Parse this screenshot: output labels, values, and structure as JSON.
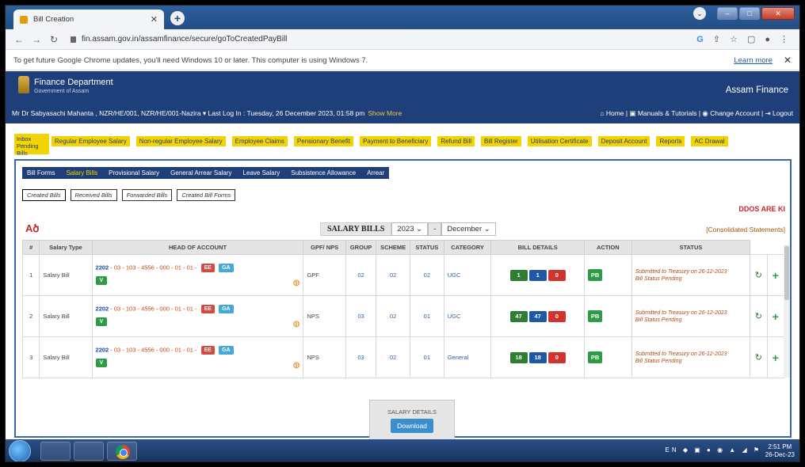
{
  "browser": {
    "tab_title": "Bill Creation",
    "url": "fin.assam.gov.in/assamfinance/secure/goToCreatedPayBill"
  },
  "infobar": {
    "message": "To get future Google Chrome updates, you'll need Windows 10 or later. This computer is using Windows 7.",
    "learn_more": "Learn more"
  },
  "site": {
    "dept": "Finance Department",
    "gov": "Government of Assam",
    "brand": "Assam Finance",
    "user_info": "Mr Dr Sabyasachi Mahanta , NZR/HE/001, NZR/HE/001-Nazira ▾   Last Log In : Tuesday, 26 December 2023, 01:58 pm",
    "show_more": "Show More",
    "user_links": "⌂ Home | ▣ Manuals & Tutorials | ◉ Change Account | ⇥ Logout"
  },
  "menu": {
    "inbox": "Inbox",
    "pending": "Pending Bills",
    "items": [
      "Regular Employee Salary",
      "Non-regular Employee Salary",
      "Employee Claims",
      "Pensionary Benefit",
      "Payment to Beneficiary",
      "Refund Bill",
      "Bill Register",
      "Utilisation Certificate",
      "Deposit Account",
      "Reports",
      "AC Drawal"
    ]
  },
  "subnav": [
    "Bill Forms",
    "Salary Bills",
    "Provisional Salary",
    "General Arrear Salary",
    "Leave Salary",
    "Subsistence Allowance",
    "Arrear"
  ],
  "subbuttons": [
    "Created Bills",
    "Received Bills",
    "Forwarded Bills",
    "Created Bill Forms"
  ],
  "ddos": "DDOS ARE KI",
  "ao_icon": "Aծ",
  "salary": {
    "label": "SALARY BILLS",
    "year": "2023",
    "month": "December",
    "consolidated": "[Consolidated Statements]"
  },
  "table": {
    "headers": [
      "#",
      "Salary Type",
      "HEAD OF ACCOUNT",
      "GPF/ NPS",
      "GROUP",
      "SCHEME",
      "STATUS",
      "CATEGORY",
      "BILL DETAILS",
      "ACTION",
      "STATUS"
    ],
    "rows": [
      {
        "n": "1",
        "type": "Salary Bill",
        "hoa_head": "2202",
        "hoa_rest": " - 03 - 103 - 4556 - 000 - 01 - 01 -",
        "gpf": "GPF",
        "group": "02",
        "scheme": "02",
        "status": "02",
        "category": "UGC",
        "d1": "1",
        "d2": "1",
        "d3": "0",
        "action": "PB",
        "stat1": "Submitted to Treasury on 26-12-2023",
        "stat2": "Bill Status Pending"
      },
      {
        "n": "2",
        "type": "Salary Bill",
        "hoa_head": "2202",
        "hoa_rest": " - 03 - 103 - 4556 - 000 - 01 - 01 -",
        "gpf": "NPS",
        "group": "03",
        "scheme": "02",
        "status": "01",
        "category": "UGC",
        "d1": "47",
        "d2": "47",
        "d3": "0",
        "action": "PB",
        "stat1": "Submitted to Treasury on 26-12-2023",
        "stat2": "Bill Status Pending"
      },
      {
        "n": "3",
        "type": "Salary Bill",
        "hoa_head": "2202",
        "hoa_rest": " - 03 - 103 - 4556 - 000 - 01 - 01 -",
        "gpf": "NPS",
        "group": "03",
        "scheme": "02",
        "status": "01",
        "category": "General",
        "d1": "18",
        "d2": "18",
        "d3": "0",
        "action": "PB",
        "stat1": "Submitted to Treasury on 26-12-2023",
        "stat2": "Bill Status Pending"
      }
    ],
    "badge_ee": "EE",
    "badge_ga": "GA",
    "badge_v": "V"
  },
  "download": {
    "title": "SALARY DETAILS",
    "button": "Download"
  },
  "taskbar": {
    "lang": "EN",
    "time": "2:51 PM",
    "date": "26-Dec-23"
  },
  "colors": {
    "header_blue": "#1f3f7a",
    "menu_yellow": "#f3d400",
    "ddos_red": "#d2232a"
  }
}
